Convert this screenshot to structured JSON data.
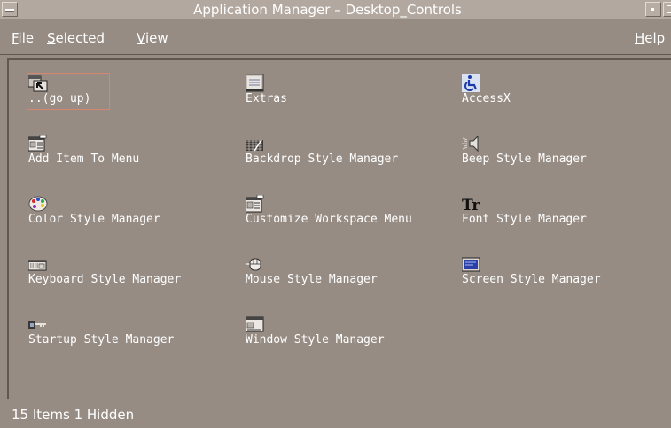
{
  "window": {
    "title": "Application Manager – Desktop_Controls"
  },
  "menubar": {
    "items": [
      {
        "label_first": "F",
        "label_rest": "ile"
      },
      {
        "label_first": "S",
        "label_rest": "elected"
      },
      {
        "label_first": "V",
        "label_rest": "iew"
      }
    ],
    "help": {
      "label_first": "H",
      "label_rest": "elp"
    }
  },
  "items": [
    {
      "label": "..(go up)",
      "icon": "go-up-icon"
    },
    {
      "label": "Extras",
      "icon": "extras-folder-icon"
    },
    {
      "label": "AccessX",
      "icon": "accessibility-icon"
    },
    {
      "label": "Add Item To Menu",
      "icon": "add-item-icon"
    },
    {
      "label": "Backdrop Style Manager",
      "icon": "backdrop-icon"
    },
    {
      "label": "Beep Style Manager",
      "icon": "speaker-icon"
    },
    {
      "label": "Color Style Manager",
      "icon": "palette-icon"
    },
    {
      "label": "Customize Workspace Menu",
      "icon": "workspace-menu-icon"
    },
    {
      "label": "Font Style Manager",
      "icon": "font-icon"
    },
    {
      "label": "Keyboard Style Manager",
      "icon": "keyboard-icon"
    },
    {
      "label": "Mouse Style Manager",
      "icon": "mouse-icon"
    },
    {
      "label": "Screen Style Manager",
      "icon": "screen-icon"
    },
    {
      "label": "Startup Style Manager",
      "icon": "startup-icon"
    },
    {
      "label": "Window Style Manager",
      "icon": "window-icon"
    }
  ],
  "font_icon_text": "Tr",
  "status": {
    "text": "15 Items 1 Hidden"
  },
  "colors": {
    "background": "#968c84",
    "titlebar": "#b3a89f",
    "text": "#ffffff",
    "selection_border": "#d68570"
  }
}
